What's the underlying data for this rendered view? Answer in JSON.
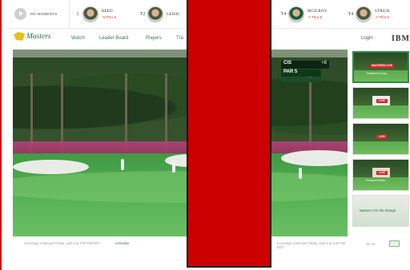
{
  "leaderboard": {
    "moments_label": "MY MOMENTS",
    "players": [
      {
        "pos": "1",
        "name": "REED",
        "score": "-9 Thru 6"
      },
      {
        "pos": "T2",
        "name": "LEISH",
        "score": ""
      },
      {
        "pos": "T4",
        "name": "MCILROY",
        "score": "-7 Thru 6"
      },
      {
        "pos": "T4",
        "name": "STRICK",
        "score": "-7 Thru 6"
      }
    ]
  },
  "nav": {
    "logo": "Masters",
    "links": [
      "Watch",
      "Leader Board",
      "Players",
      "Tra"
    ],
    "login": "Login",
    "sponsor": "IBM"
  },
  "video": {
    "overlay_name": "CIS",
    "overlay_score": "+8",
    "overlay_par": "PAR 5",
    "caption_left": "Coverage continues Friday, April 6 at 2:00 PM EDT",
    "caption_schedule": "Schedule",
    "caption_right": "Coverage continues Friday, April 6 at 2:00 PM EDT",
    "on_air_label": "On Air"
  },
  "channels": [
    {
      "badge": "MASTERS LIVE",
      "label": "Featured Group"
    },
    {
      "badge": "LIVE",
      "label": ""
    },
    {
      "badge": "LIVE",
      "label": ""
    },
    {
      "badge": "LIVE",
      "label": "Featured Holes"
    },
    {
      "badge": "",
      "label": "Masters On the Range"
    }
  ],
  "colors": {
    "brand_green": "#1d6b3a",
    "live_red": "#d62828",
    "occlusion_red": "#cc0000"
  }
}
